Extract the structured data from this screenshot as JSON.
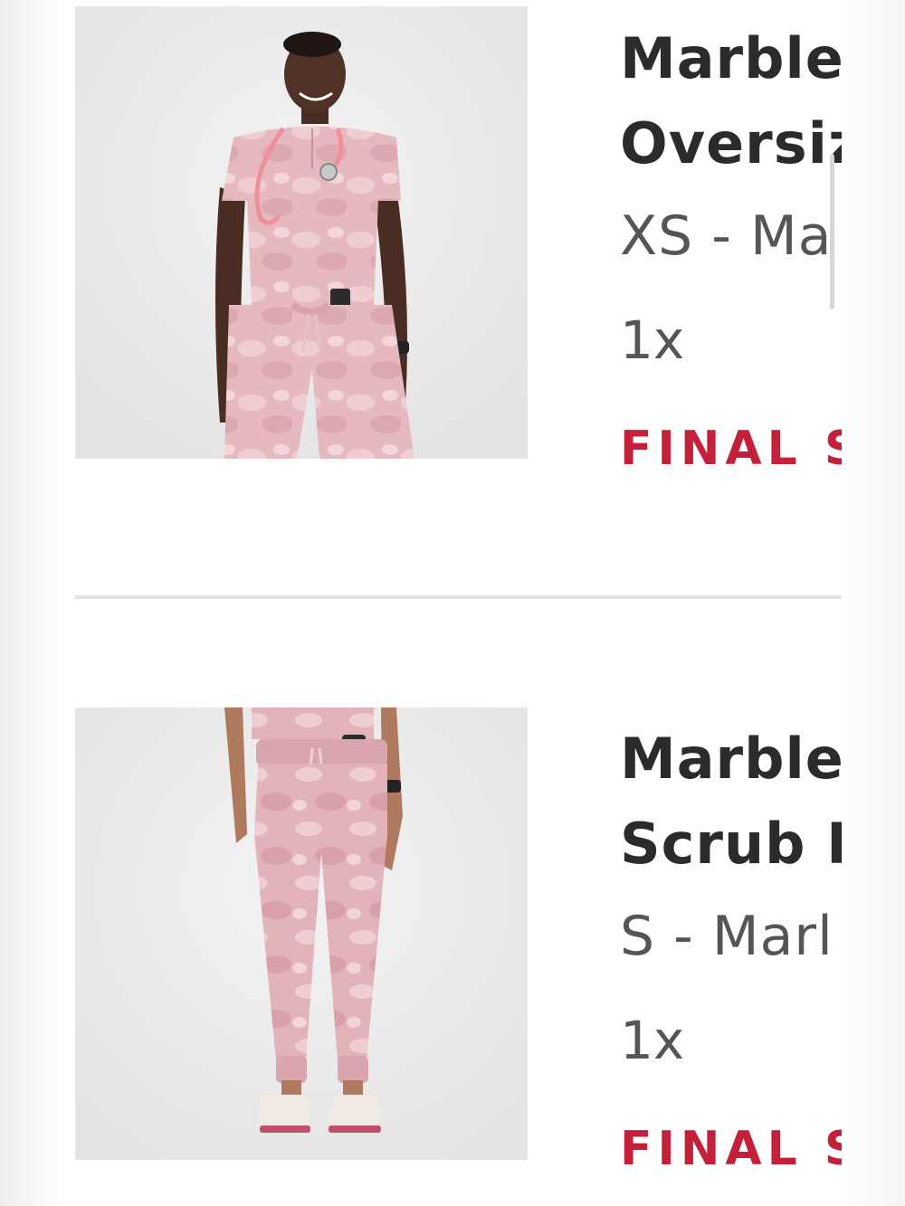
{
  "items": [
    {
      "title_line1": "Marblec",
      "title_line2": "Oversiz",
      "variant": "XS - Ma",
      "quantity": "1x",
      "final_sale": "FINAL S",
      "image_icon": "scrub-top-model-photo"
    },
    {
      "title_line1": "Marblec",
      "title_line2": "Scrub P",
      "variant": "S - Marl",
      "quantity": "1x",
      "final_sale": "FINAL S",
      "image_icon": "scrub-pants-model-photo"
    }
  ],
  "colors": {
    "accent": "#c5203a",
    "title": "#2b2b2b",
    "meta": "#555555",
    "product_pink": "#e4b7bd"
  }
}
